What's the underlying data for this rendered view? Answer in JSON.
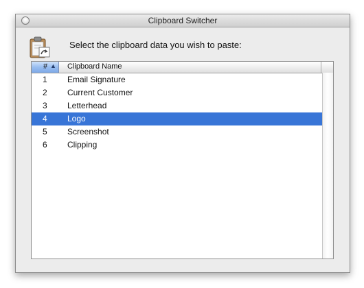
{
  "window": {
    "title": "Clipboard Switcher"
  },
  "header": {
    "prompt": "Select the clipboard data you wish to paste:",
    "icon": "clipboard-paste-icon"
  },
  "table": {
    "columns": {
      "number": "#",
      "name": "Clipboard Name"
    },
    "sort_indicator": "▲",
    "rows": [
      {
        "num": "1",
        "name": "Email Signature",
        "selected": false
      },
      {
        "num": "2",
        "name": "Current Customer",
        "selected": false
      },
      {
        "num": "3",
        "name": "Letterhead",
        "selected": false
      },
      {
        "num": "4",
        "name": "Logo",
        "selected": true
      },
      {
        "num": "5",
        "name": "Screenshot",
        "selected": false
      },
      {
        "num": "6",
        "name": "Clipping",
        "selected": false
      }
    ]
  },
  "colors": {
    "selection": "#3875d7",
    "sorted_header": "#98bdf0"
  }
}
